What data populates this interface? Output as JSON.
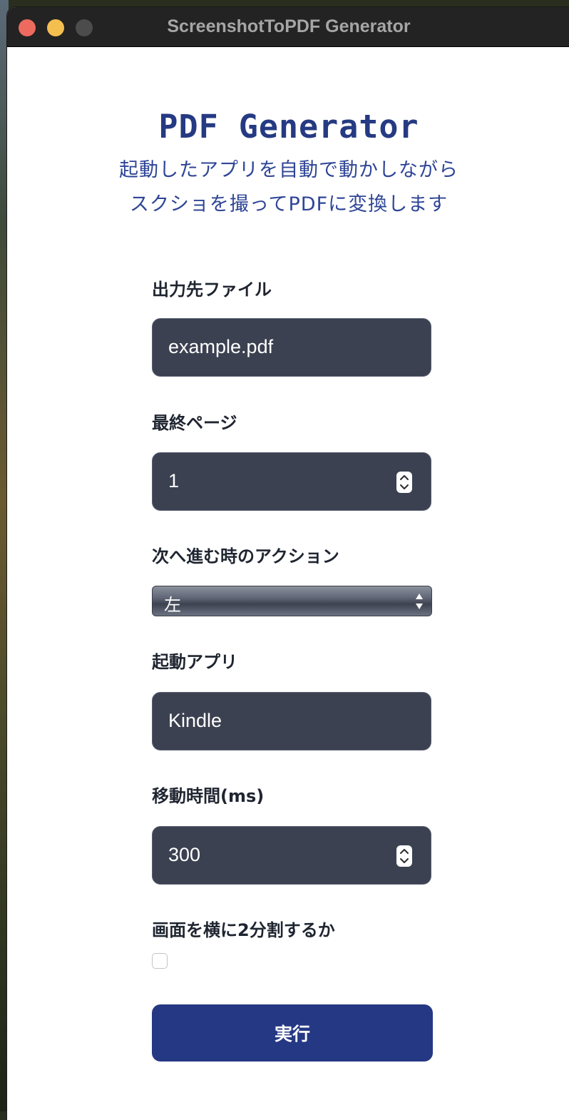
{
  "window": {
    "title": "ScreenshotToPDF Generator"
  },
  "header": {
    "title": "PDF Generator",
    "subtitle_line1": "起動したアプリを自動で動かしながら",
    "subtitle_line2": "スクショを撮ってPDFに変換します"
  },
  "form": {
    "output_file": {
      "label": "出力先ファイル",
      "value": "example.pdf"
    },
    "last_page": {
      "label": "最終ページ",
      "value": "1"
    },
    "next_action": {
      "label": "次へ進む時のアクション",
      "selected": "左"
    },
    "app": {
      "label": "起動アプリ",
      "value": "Kindle"
    },
    "move_time": {
      "label": "移動時間(ms)",
      "value": "300"
    },
    "split": {
      "label": "画面を横に2分割するか",
      "checked": false
    },
    "submit_label": "実行"
  },
  "colors": {
    "accent": "#253884",
    "title": "#253a82",
    "field_bg": "#3b4150"
  }
}
